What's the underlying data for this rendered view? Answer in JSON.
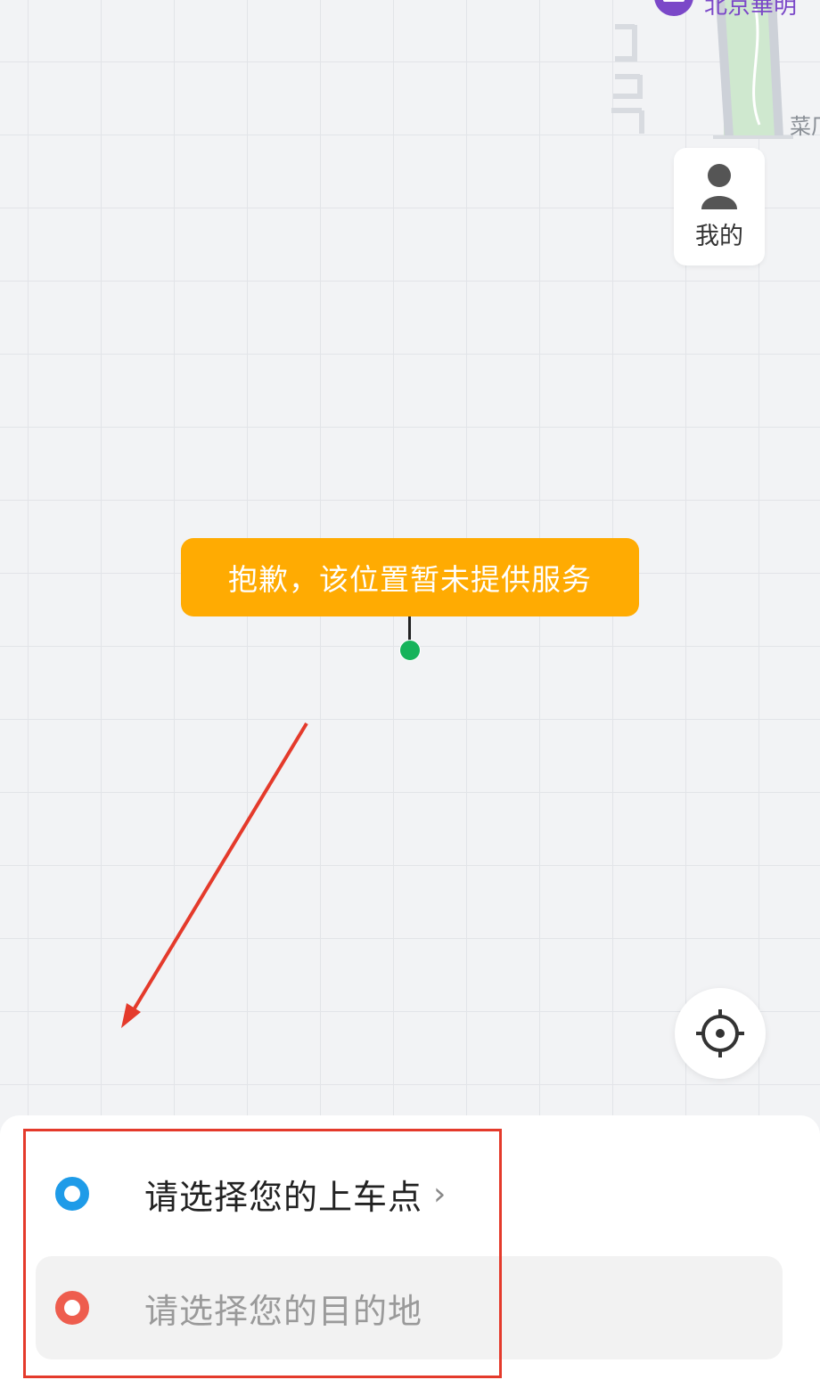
{
  "map": {
    "poi_label": "北京華明",
    "road_label": "菜厂",
    "colors": {
      "park": "#cfe8cf",
      "poi": "#7b48c8",
      "road": "#d0d4dc"
    }
  },
  "mine_button": {
    "label": "我的",
    "icon": "person-icon"
  },
  "tooltip": {
    "text": "抱歉，该位置暂未提供服务",
    "color": "#ffab02"
  },
  "pin": {
    "color": "#16b35a"
  },
  "locate_button": {
    "icon": "crosshair-icon"
  },
  "trip": {
    "pickup": {
      "text": "请选择您的上车点",
      "chevron": "chevron-right-icon",
      "dot_color": "#1e9be8"
    },
    "destination": {
      "placeholder": "请选择您的目的地",
      "dot_color": "#ee5d4e"
    }
  },
  "annotation": {
    "color": "#e43a2b"
  }
}
